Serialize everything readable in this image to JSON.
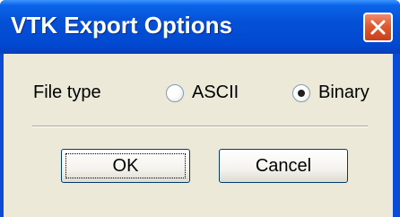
{
  "window": {
    "title": "VTK Export Options",
    "close_icon": "close-icon"
  },
  "file_type": {
    "label": "File type",
    "options": [
      {
        "label": "ASCII",
        "selected": false
      },
      {
        "label": "Binary",
        "selected": true
      }
    ]
  },
  "buttons": {
    "ok_label": "OK",
    "cancel_label": "Cancel"
  },
  "colors": {
    "titlebar": "#0551d6",
    "dialog_background": "#ece9d8",
    "close_button": "#e05a30"
  }
}
